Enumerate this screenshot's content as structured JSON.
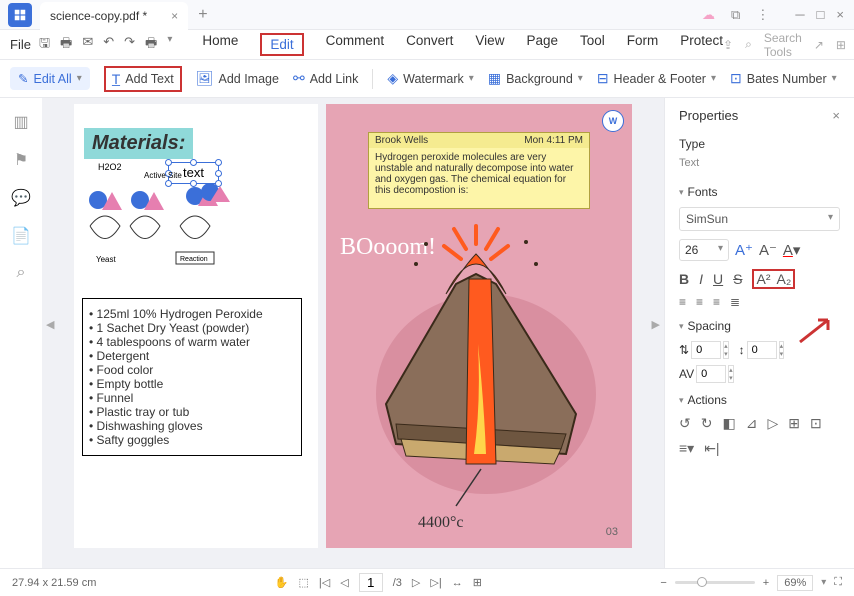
{
  "titlebar": {
    "filename": "science-copy.pdf *"
  },
  "menubar": {
    "file": "File",
    "main": [
      "Home",
      "Edit",
      "Comment",
      "Convert",
      "View",
      "Page",
      "Tool",
      "Form",
      "Protect"
    ],
    "search_placeholder": "Search Tools"
  },
  "toolbar": {
    "edit_all": "Edit All",
    "add_text": "Add Text",
    "add_image": "Add Image",
    "add_link": "Add Link",
    "watermark": "Watermark",
    "background": "Background",
    "header_footer": "Header & Footer",
    "bates": "Bates Number"
  },
  "page_left": {
    "materials_header": "Materials:",
    "editable_text": "text",
    "labels": {
      "h2o2": "H2O2",
      "active": "Active Site",
      "yeast": "Yeast",
      "reaction": "Reaction"
    },
    "list": [
      "125ml 10% Hydrogen Peroxide",
      "1 Sachet Dry Yeast (powder)",
      "4 tablespoons of warm water",
      "Detergent",
      "Food color",
      "Empty bottle",
      "Funnel",
      "Plastic tray or tub",
      "Dishwashing gloves",
      "Safty goggles"
    ]
  },
  "page_right": {
    "note_author": "Brook Wells",
    "note_time": "Mon 4:11 PM",
    "note_body": "Hydrogen peroxide molecules are very unstable and naturally decompose into water and oxygen gas. The chemical equation for this decompostion is:",
    "boom": "BOooom!",
    "temp": "4400°c",
    "page_num": "03"
  },
  "props": {
    "title": "Properties",
    "type_label": "Type",
    "type_value": "Text",
    "fonts_label": "Fonts",
    "font_name": "SimSun",
    "font_size": "26",
    "spacing_label": "Spacing",
    "spacing_val": "0",
    "actions_label": "Actions"
  },
  "statusbar": {
    "dims": "27.94 x 21.59 cm",
    "page_cur": "1",
    "page_total": "/3",
    "zoom": "69%"
  }
}
